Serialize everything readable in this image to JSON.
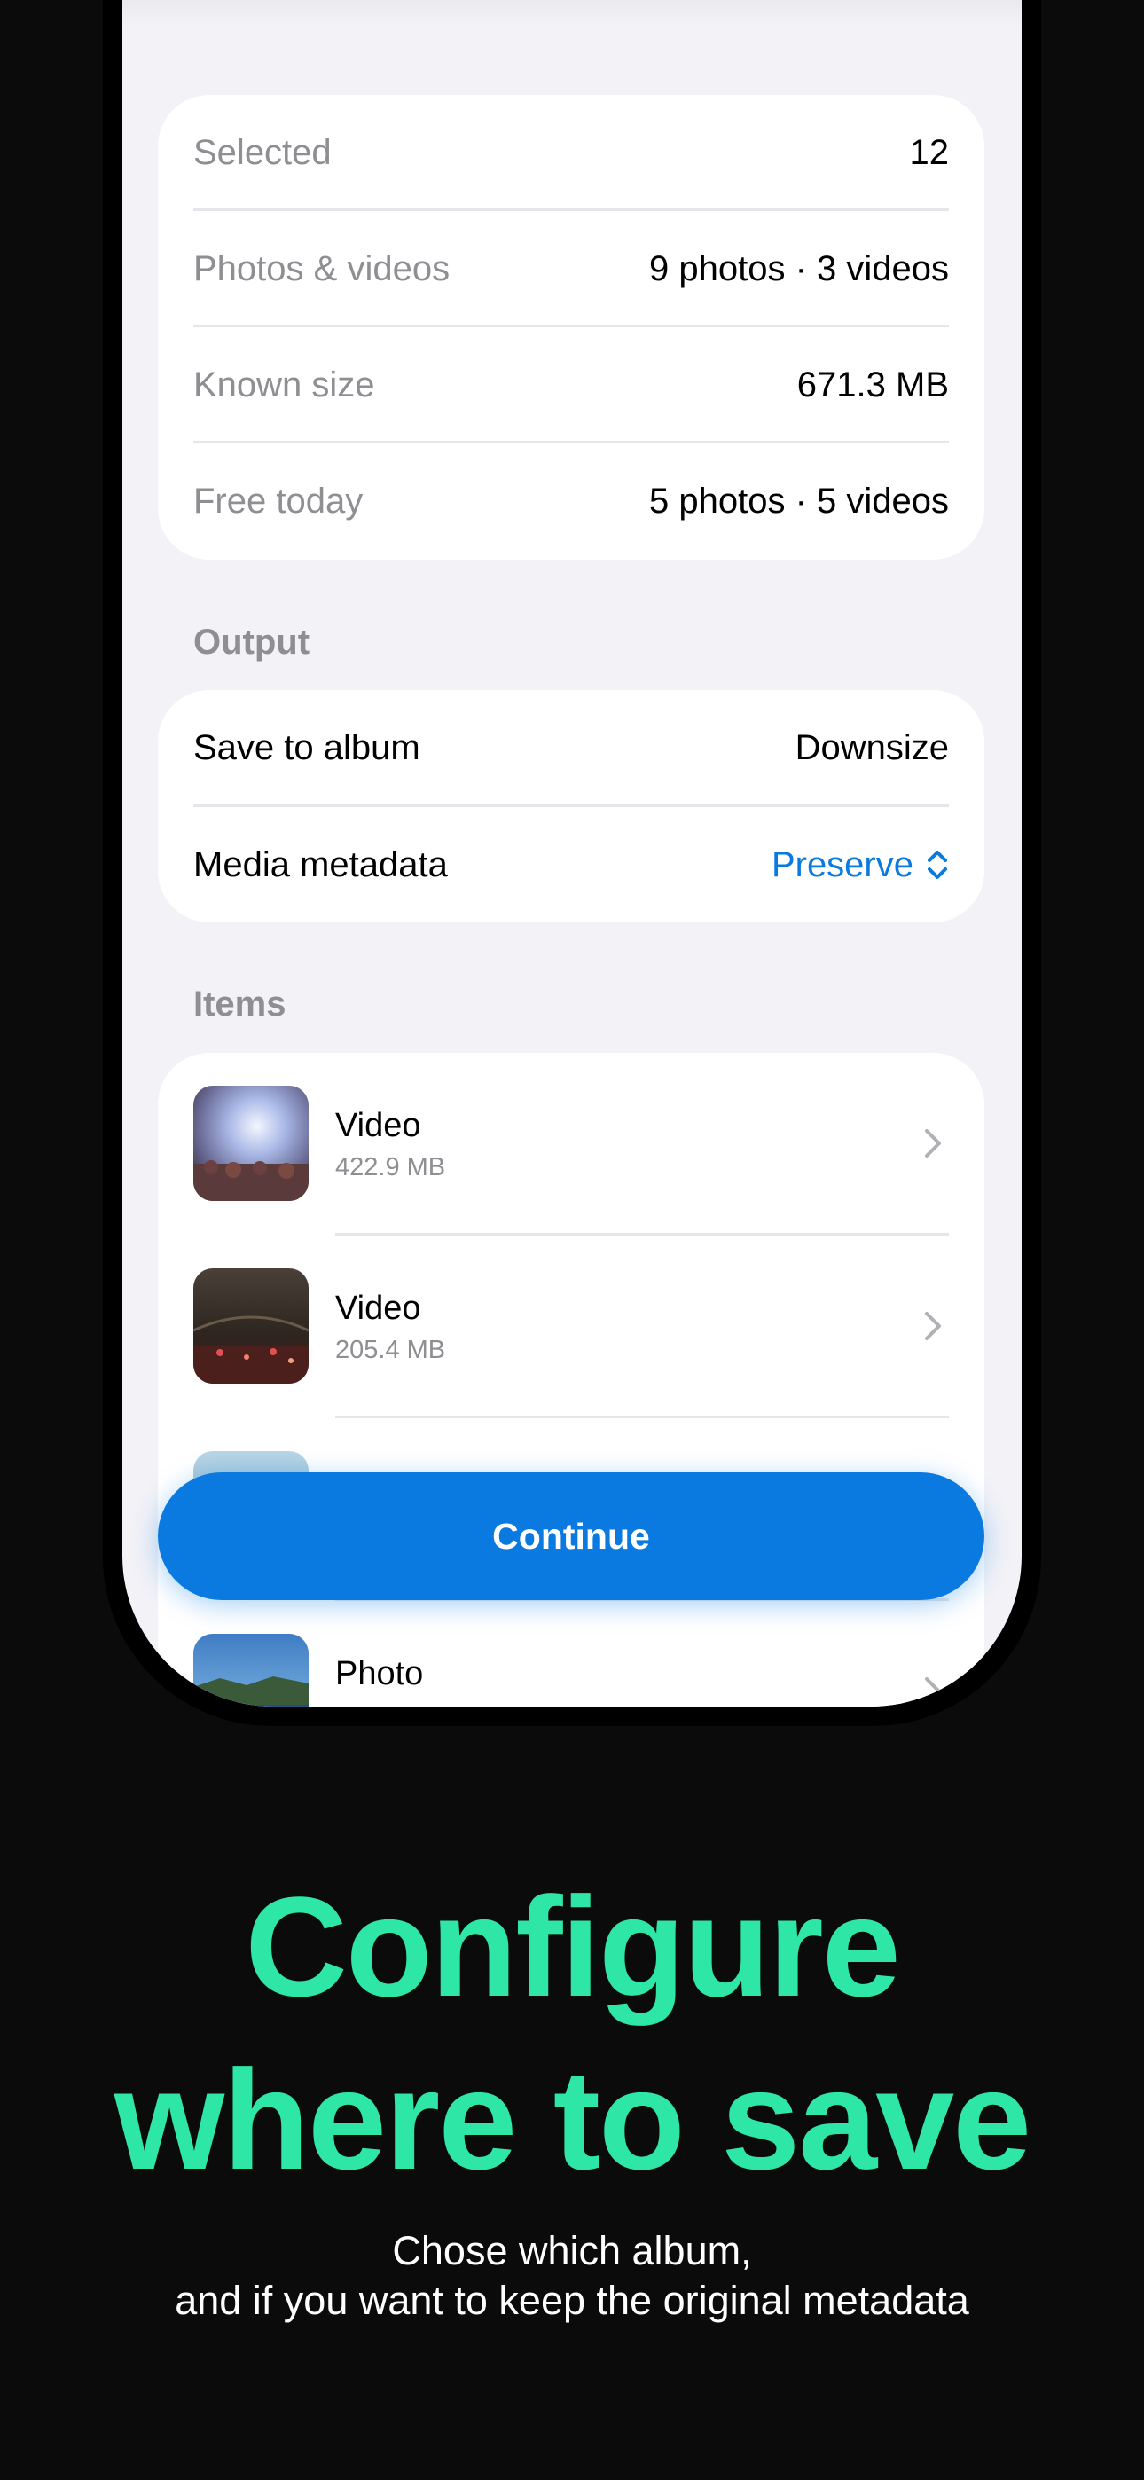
{
  "summary": {
    "selected_label": "Selected",
    "selected_value": "12",
    "photos_videos_label": "Photos & videos",
    "photos_videos_value": "9 photos · 3 videos",
    "known_size_label": "Known size",
    "known_size_value": "671.3 MB",
    "free_today_label": "Free today",
    "free_today_value": "5 photos · 5 videos"
  },
  "output": {
    "header": "Output",
    "save_to_album_label": "Save to album",
    "save_to_album_value": "Downsize",
    "media_metadata_label": "Media metadata",
    "media_metadata_value": "Preserve"
  },
  "items": {
    "header": "Items",
    "list": [
      {
        "title": "Video",
        "size": "422.9 MB",
        "thumb": "concert-lights"
      },
      {
        "title": "Video",
        "size": "205.4 MB",
        "thumb": "concert-crowd"
      },
      {
        "title": "",
        "size": "",
        "thumb": "sky-partial"
      },
      {
        "title": "Photo",
        "size": "",
        "thumb": "coastline"
      }
    ]
  },
  "continue_label": "Continue",
  "marketing": {
    "headline_line1": "Configure",
    "headline_line2": "where to save",
    "sub_line1": "Chose which album,",
    "sub_line2": "and if you want to keep the original metadata"
  },
  "colors": {
    "accent": "#0a7ae0",
    "headline": "#2ee6a6",
    "background": "#0b0b0b",
    "screen_bg": "#f2f2f7"
  },
  "icons": {
    "chevron": "chevron-right-icon",
    "picker": "chevron-up-down-icon"
  }
}
